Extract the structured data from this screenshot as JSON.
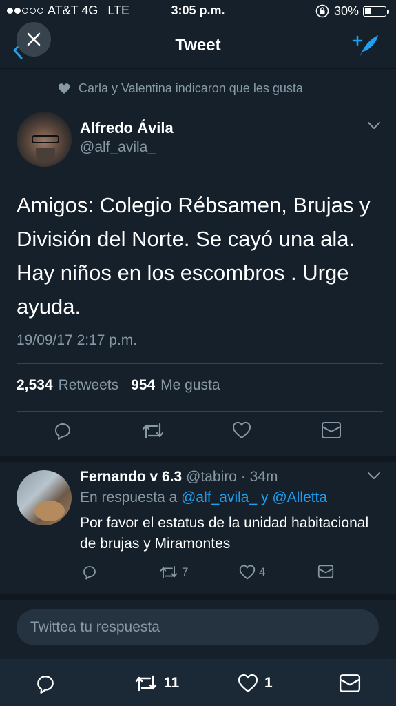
{
  "status_bar": {
    "carrier": "AT&T 4G",
    "network": "LTE",
    "time": "3:05 p.m.",
    "battery": "30%",
    "battery_level": 0.3
  },
  "nav": {
    "title": "Tweet",
    "icons": [
      "back-chevron-icon",
      "close-icon",
      "compose-tweet-icon"
    ]
  },
  "social_context": "Carla y Valentina indicaron que les gusta",
  "tweet": {
    "author_name": "Alfredo Ávila",
    "author_handle": "@alf_avila_",
    "text": "Amigos: Colegio Rébsamen, Brujas y División del Norte. Se cayó una ala. Hay niños en los escombros . Urge ayuda.",
    "timestamp": "19/09/17 2:17 p.m.",
    "retweet_count": "2,534",
    "retweet_label": "Retweets",
    "like_count": "954",
    "like_label": "Me gusta"
  },
  "reply": {
    "author_name": "Fernando v 6.3",
    "author_handle": "@tabiro",
    "separator": "·",
    "time_ago": "34m",
    "reply_prefix": "En respuesta a",
    "mention_1": "@alf_avila_",
    "conjunction": "y",
    "mention_2": "@Alletta",
    "text": "Por favor el estatus de la unidad habitacional de brujas y Miramontes",
    "retweet_count": "7",
    "like_count": "4"
  },
  "composer": {
    "placeholder": "Twittea tu respuesta"
  },
  "bottom_bar": {
    "retweet_count": "11",
    "like_count": "1"
  },
  "colors": {
    "background": "#15202b",
    "accent": "#1da1f2",
    "muted_text": "#8899a6"
  }
}
